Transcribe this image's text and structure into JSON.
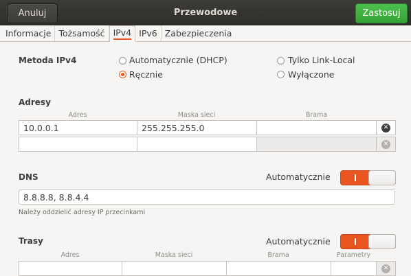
{
  "header": {
    "title": "Przewodowe",
    "cancel_label": "Anuluj",
    "apply_label": "Zastosuj"
  },
  "tabs": [
    {
      "label": "Informacje",
      "active": false
    },
    {
      "label": "Tożsamość",
      "active": false
    },
    {
      "label": "IPv4",
      "active": true
    },
    {
      "label": "IPv6",
      "active": false
    },
    {
      "label": "Zabezpieczenia",
      "active": false
    }
  ],
  "method": {
    "label": "Metoda IPv4",
    "options": [
      {
        "label": "Automatycznie (DHCP)",
        "checked": false
      },
      {
        "label": "Ręcznie",
        "checked": true
      },
      {
        "label": "Tylko Link-Local",
        "checked": false
      },
      {
        "label": "Wyłączone",
        "checked": false
      }
    ]
  },
  "addresses": {
    "label": "Adresy",
    "columns": [
      "Adres",
      "Maska sieci",
      "Brama"
    ],
    "rows": [
      [
        "10.0.0.1",
        "255.255.255.0",
        ""
      ],
      [
        "",
        "",
        ""
      ]
    ]
  },
  "dns": {
    "label": "DNS",
    "auto_label": "Automatycznie",
    "auto_on": true,
    "value": "8.8.8.8, 8.8.4.4",
    "hint": "Należy oddzielić adresy IP przecinkami"
  },
  "routes": {
    "label": "Trasy",
    "auto_label": "Automatycznie",
    "auto_on": true,
    "columns": [
      "Adres",
      "Maska sieci",
      "Brama",
      "Parametry"
    ]
  },
  "colors": {
    "accent": "#e95420",
    "apply": "#3eb13e",
    "header_bg": "#353430"
  }
}
